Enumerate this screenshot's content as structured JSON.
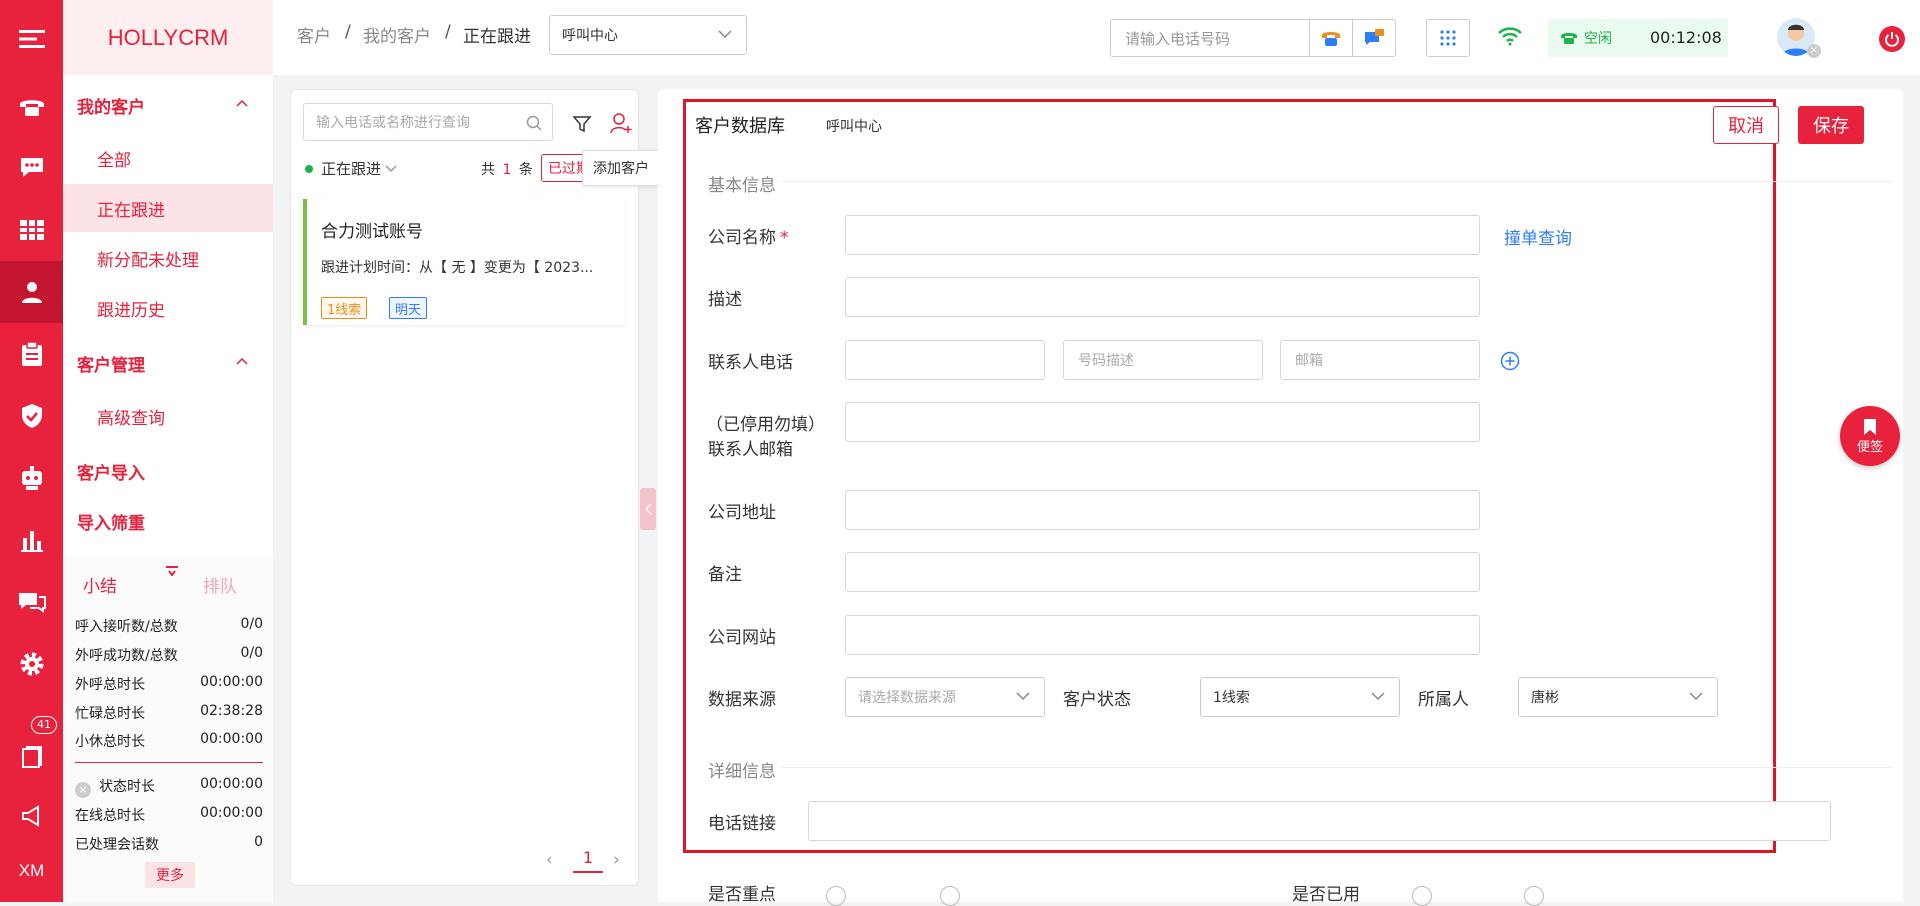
{
  "brand": "HOLLYCRM",
  "rail": {
    "badge_count": "41",
    "bottom_label": "XM"
  },
  "sidebar": {
    "group_my_customers": "我的客户",
    "items_my": [
      "全部",
      "正在跟进",
      "新分配未处理",
      "跟进历史"
    ],
    "group_customer_mgmt": "客户管理",
    "items_mgmt": [
      "高级查询"
    ],
    "group_import": "客户导入",
    "group_filter": "导入筛重"
  },
  "stats": {
    "tab_summary": "小结",
    "tab_queue": "排队",
    "rows": [
      {
        "label": "呼入接听数/总数",
        "value": "0/0"
      },
      {
        "label": "外呼成功数/总数",
        "value": "0/0"
      },
      {
        "label": "外呼总时长",
        "value": "00:00:00"
      },
      {
        "label": "忙碌总时长",
        "value": "02:38:28"
      },
      {
        "label": "小休总时长",
        "value": "00:00:00"
      }
    ],
    "rows2": [
      {
        "label": "状态时长",
        "value": "00:00:00"
      },
      {
        "label": "在线总时长",
        "value": "00:00:00"
      },
      {
        "label": "已处理会话数",
        "value": "0"
      }
    ],
    "more_label": "更多"
  },
  "topbar": {
    "breadcrumb": [
      "客户",
      "我的客户",
      "正在跟进"
    ],
    "center_select": "呼叫中心",
    "phone_placeholder": "请输入电话号码",
    "status_label": "空闲",
    "timer": "00:12:08"
  },
  "list_panel": {
    "search_placeholder": "输入电话或名称进行查询",
    "filter_label": "正在跟进",
    "count_prefix": "共",
    "count_value": "1",
    "count_suffix": "条",
    "expired_label": "已过期",
    "tooltip": "添加客户",
    "card": {
      "title": "合力测试账号",
      "desc": "跟进计划时间：从【 无 】变更为【 2023...",
      "tag1": "1线索",
      "tag2": "明天"
    },
    "page": "1"
  },
  "form": {
    "title": "客户数据库",
    "subtitle": "呼叫中心",
    "cancel": "取消",
    "save": "保存",
    "section_basic": "基本信息",
    "company_name": "公司名称",
    "required_mark": "*",
    "check_dup": "撞单查询",
    "description": "描述",
    "contact_phone": "联系人电话",
    "number_desc_placeholder": "号码描述",
    "email_placeholder": "邮箱",
    "contact_email_line1": "（已停用勿填）",
    "contact_email_line2": "联系人邮箱",
    "company_address": "公司地址",
    "remark": "备注",
    "company_website": "公司网站",
    "data_source": "数据来源",
    "data_source_placeholder": "请选择数据来源",
    "customer_status": "客户状态",
    "customer_status_value": "1线索",
    "owner": "所属人",
    "owner_value": "唐彬",
    "section_detail": "详细信息",
    "phone_link": "电话链接",
    "cut1": "是否重点",
    "cut2": "是否已用"
  },
  "memo": "便签",
  "colors": {
    "brand": "#e8213d",
    "status_green": "#1db34a",
    "link_blue": "#2d7ff9"
  }
}
